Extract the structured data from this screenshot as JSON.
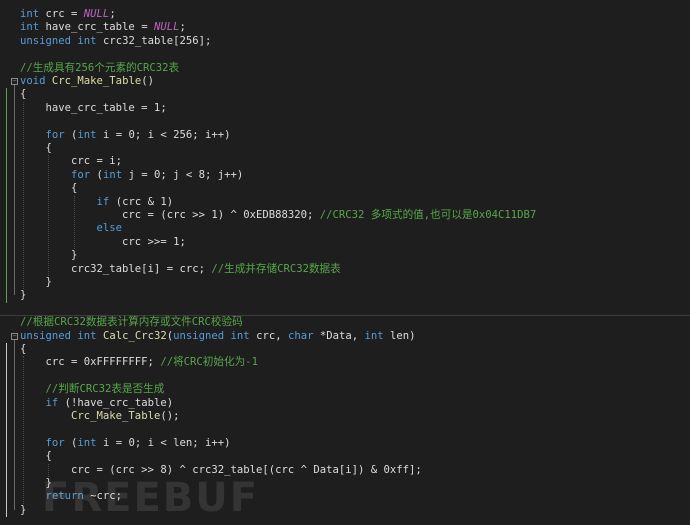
{
  "editor": {
    "lines": [
      [
        [
          "kw",
          "int"
        ],
        [
          "t",
          " crc = "
        ],
        [
          "mac",
          "NULL"
        ],
        [
          "t",
          ";"
        ]
      ],
      [
        [
          "kw",
          "int"
        ],
        [
          "t",
          " have_crc_table = "
        ],
        [
          "mac",
          "NULL"
        ],
        [
          "t",
          ";"
        ]
      ],
      [
        [
          "kw",
          "unsigned"
        ],
        [
          "t",
          " "
        ],
        [
          "kw",
          "int"
        ],
        [
          "t",
          " crc32_table[256];"
        ]
      ],
      [],
      [
        [
          "cm",
          "//生成具有256个元素的CRC32表"
        ]
      ],
      [
        [
          "kw",
          "void"
        ],
        [
          "t",
          " "
        ],
        [
          "fn",
          "Crc_Make_Table"
        ],
        [
          "t",
          "()"
        ]
      ],
      [
        [
          "t",
          "{"
        ]
      ],
      [
        [
          "t",
          "    have_crc_table = 1;"
        ]
      ],
      [],
      [
        [
          "t",
          "    "
        ],
        [
          "kw",
          "for"
        ],
        [
          "t",
          " ("
        ],
        [
          "kw",
          "int"
        ],
        [
          "t",
          " i = 0; i < 256; i++)"
        ]
      ],
      [
        [
          "t",
          "    {"
        ]
      ],
      [
        [
          "t",
          "        crc = i;"
        ]
      ],
      [
        [
          "t",
          "        "
        ],
        [
          "kw",
          "for"
        ],
        [
          "t",
          " ("
        ],
        [
          "kw",
          "int"
        ],
        [
          "t",
          " j = 0; j < 8; j++)"
        ]
      ],
      [
        [
          "t",
          "        {"
        ]
      ],
      [
        [
          "t",
          "            "
        ],
        [
          "kw",
          "if"
        ],
        [
          "t",
          " (crc & 1)"
        ]
      ],
      [
        [
          "t",
          "                crc = (crc >> 1) ^ 0xEDB88320; "
        ],
        [
          "cm",
          "//CRC32 多项式的值,也可以是0x04C11DB7"
        ]
      ],
      [
        [
          "t",
          "            "
        ],
        [
          "kw",
          "else"
        ]
      ],
      [
        [
          "t",
          "                crc >>= 1;"
        ]
      ],
      [
        [
          "t",
          "        }"
        ]
      ],
      [
        [
          "t",
          "        crc32_table[i] = crc; "
        ],
        [
          "cm",
          "//生成并存储CRC32数据表"
        ]
      ],
      [
        [
          "t",
          "    }"
        ]
      ],
      [
        [
          "t",
          "}"
        ]
      ],
      [],
      [
        [
          "cm",
          "//根据CRC32数据表计算内存或文件CRC校验码"
        ]
      ],
      [
        [
          "kw",
          "unsigned"
        ],
        [
          "t",
          " "
        ],
        [
          "kw",
          "int"
        ],
        [
          "t",
          " "
        ],
        [
          "fn",
          "Calc_Crc32"
        ],
        [
          "t",
          "("
        ],
        [
          "kw",
          "unsigned"
        ],
        [
          "t",
          " "
        ],
        [
          "kw",
          "int"
        ],
        [
          "t",
          " crc, "
        ],
        [
          "kw",
          "char"
        ],
        [
          "t",
          " *Data, "
        ],
        [
          "kw",
          "int"
        ],
        [
          "t",
          " len)"
        ]
      ],
      [
        [
          "t",
          "{"
        ]
      ],
      [
        [
          "t",
          "    crc = 0xFFFFFFFF; "
        ],
        [
          "cm",
          "//将CRC初始化为-1"
        ]
      ],
      [],
      [
        [
          "t",
          "    "
        ],
        [
          "cm",
          "//判断CRC32表是否生成"
        ]
      ],
      [
        [
          "t",
          "    "
        ],
        [
          "kw",
          "if"
        ],
        [
          "t",
          " (!have_crc_table)"
        ]
      ],
      [
        [
          "t",
          "        "
        ],
        [
          "fn",
          "Crc_Make_Table"
        ],
        [
          "t",
          "();"
        ]
      ],
      [],
      [
        [
          "t",
          "    "
        ],
        [
          "kw",
          "for"
        ],
        [
          "t",
          " ("
        ],
        [
          "kw",
          "int"
        ],
        [
          "t",
          " i = 0; i < len; i++)"
        ]
      ],
      [
        [
          "t",
          "    {"
        ]
      ],
      [
        [
          "t",
          "        crc = (crc >> 8) ^ crc32_table[(crc ^ Data[i]) & 0xff];"
        ]
      ],
      [
        [
          "t",
          "    }"
        ]
      ],
      [
        [
          "t",
          "    "
        ],
        [
          "kw",
          "return"
        ],
        [
          "t",
          " ~crc;"
        ]
      ],
      [
        [
          "t",
          "}"
        ]
      ]
    ],
    "fold_markers": [
      5,
      24
    ],
    "colors": {
      "background": "#1e1e1e",
      "keyword": "#569cd6",
      "function": "#dcdcaa",
      "comment": "#57a64a",
      "macro": "#bd63c5",
      "text": "#dcdcdc",
      "change_bar_saved": "#57a64a",
      "change_bar_unsaved": "#c8c8c8"
    }
  },
  "watermark": {
    "text": "FREEBUF"
  }
}
